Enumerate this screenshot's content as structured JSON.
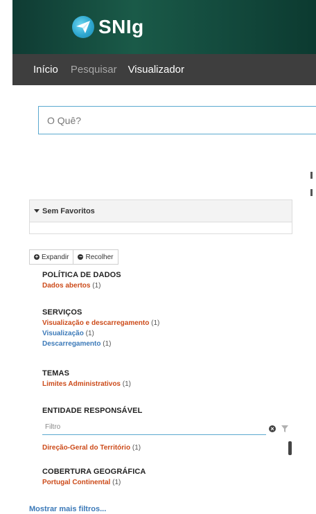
{
  "header": {
    "logo_text_prefix": "SN",
    "logo_text_suffix": "Ig",
    "colors": {
      "banner": "#134a3d",
      "navbar": "#3e3e3e"
    }
  },
  "nav": {
    "items": [
      {
        "label": "Início"
      },
      {
        "label": "Pesquisar"
      },
      {
        "label": "Visualizador"
      }
    ]
  },
  "search": {
    "placeholder": "O Quê?",
    "value": ""
  },
  "favorites": {
    "title": "Sem Favoritos"
  },
  "buttons": {
    "expand": "Expandir",
    "collapse": "Recolher"
  },
  "facets": {
    "politica": {
      "title": "POLÍTICA DE DADOS",
      "items": [
        {
          "label": "Dados abertos",
          "count": "(1)"
        }
      ]
    },
    "servicos": {
      "title": "SERVIÇOS",
      "items": [
        {
          "label": "Visualização e descarregamento",
          "count": "(1)"
        },
        {
          "label": "Visualização",
          "count": "(1)"
        },
        {
          "label": "Descarregamento",
          "count": "(1)"
        }
      ]
    },
    "temas": {
      "title": "TEMAS",
      "items": [
        {
          "label": "Limites Administrativos",
          "count": "(1)"
        }
      ]
    },
    "entidade": {
      "title": "ENTIDADE RESPONSÁVEL",
      "filter_placeholder": "Filtro",
      "items": [
        {
          "label": "Direção-Geral do Território",
          "count": "(1)"
        }
      ]
    },
    "cobertura": {
      "title": "COBERTURA GEOGRÁFICA",
      "items": [
        {
          "label": "Portugal Continental",
          "count": "(1)"
        }
      ]
    }
  },
  "more_filters": "Mostrar mais filtros...",
  "accent_colors": {
    "orange": "#cc4b1a",
    "blue": "#3b79b8"
  }
}
